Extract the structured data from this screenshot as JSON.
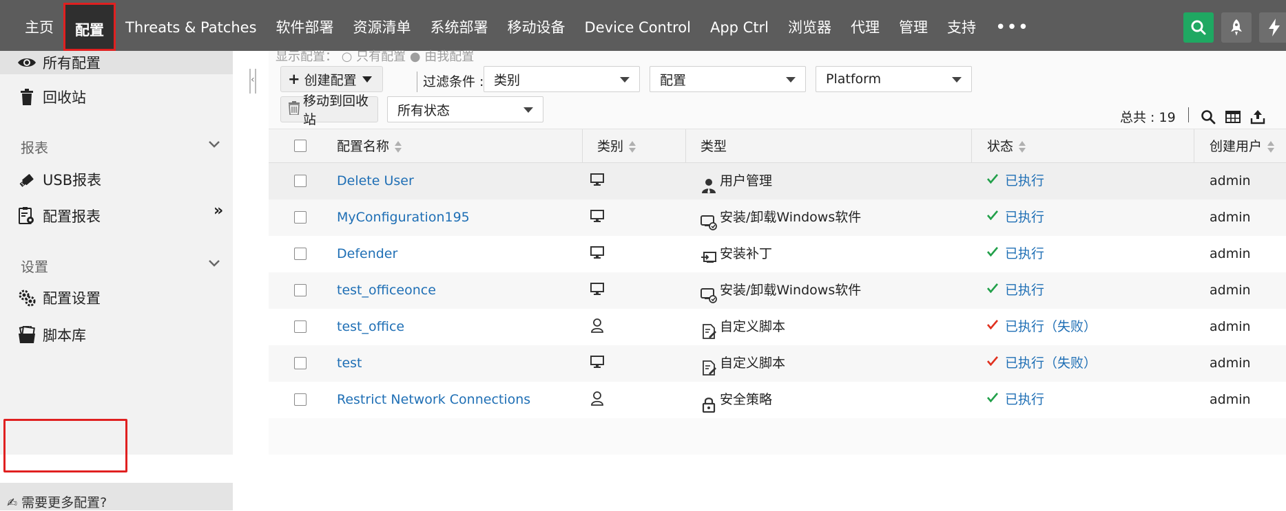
{
  "nav": {
    "items": [
      {
        "label": "主页",
        "active": false
      },
      {
        "label": "配置",
        "active": true
      },
      {
        "label": "Threats & Patches",
        "active": false
      },
      {
        "label": "软件部署",
        "active": false
      },
      {
        "label": "资源清单",
        "active": false
      },
      {
        "label": "系统部署",
        "active": false
      },
      {
        "label": "移动设备",
        "active": false
      },
      {
        "label": "Device Control",
        "active": false
      },
      {
        "label": "App Ctrl",
        "active": false
      },
      {
        "label": "浏览器",
        "active": false
      },
      {
        "label": "代理",
        "active": false
      },
      {
        "label": "管理",
        "active": false
      },
      {
        "label": "支持",
        "active": false
      },
      {
        "label": "•••",
        "active": false
      }
    ]
  },
  "sidebar": {
    "all_configs": "所有配置",
    "recycle_bin": "回收站",
    "reports_heading": "报表",
    "usb_report": "USB报表",
    "config_report": "配置报表",
    "settings_heading": "设置",
    "config_settings": "配置设置",
    "script_library": "脚本库",
    "need_more": "需要更多配置?"
  },
  "toolbar": {
    "top_cut_text": "显示配置：  ○ 只有配置  ● 由我配置",
    "create_config": "创建配置",
    "filter_label": "过滤条件 :",
    "filter_category": "类别",
    "filter_config": "配置",
    "filter_platform": "Platform",
    "move_to_recycle": "移动到回收站",
    "status_filter": "所有状态",
    "total": "总共 : 19"
  },
  "table": {
    "headers": {
      "name": "配置名称",
      "category": "类别",
      "type": "类型",
      "status": "状态",
      "created_by": "创建用户"
    },
    "rows": [
      {
        "name": "Delete User",
        "category": "computer",
        "type": "用户管理",
        "type_icon": "user-admin",
        "status": "已执行",
        "status_state": "ok",
        "created_by": "admin"
      },
      {
        "name": "MyConfiguration195",
        "category": "computer",
        "type": "安装/卸载Windows软件",
        "type_icon": "software",
        "status": "已执行",
        "status_state": "ok",
        "created_by": "admin"
      },
      {
        "name": "Defender",
        "category": "computer",
        "type": "安装补丁",
        "type_icon": "patch",
        "status": "已执行",
        "status_state": "ok",
        "created_by": "admin"
      },
      {
        "name": "test_officeonce",
        "category": "computer",
        "type": "安装/卸载Windows软件",
        "type_icon": "software",
        "status": "已执行",
        "status_state": "ok",
        "created_by": "admin"
      },
      {
        "name": "test_office",
        "category": "user",
        "type": "自定义脚本",
        "type_icon": "script",
        "status": "已执行（失败）",
        "status_state": "failed",
        "created_by": "admin"
      },
      {
        "name": "test",
        "category": "computer",
        "type": "自定义脚本",
        "type_icon": "script",
        "status": "已执行（失败）",
        "status_state": "failed",
        "created_by": "admin"
      },
      {
        "name": "Restrict Network Connections",
        "category": "user",
        "type": "安全策略",
        "type_icon": "lock",
        "status": "已执行",
        "status_state": "ok",
        "created_by": "admin"
      }
    ]
  },
  "colors": {
    "nav_bg": "#5c5c5c",
    "accent_green": "#1fa862",
    "link_blue": "#1f6fb5",
    "ok_check": "#22a04a",
    "fail_check": "#e0311f",
    "highlight_red": "#e02020"
  }
}
